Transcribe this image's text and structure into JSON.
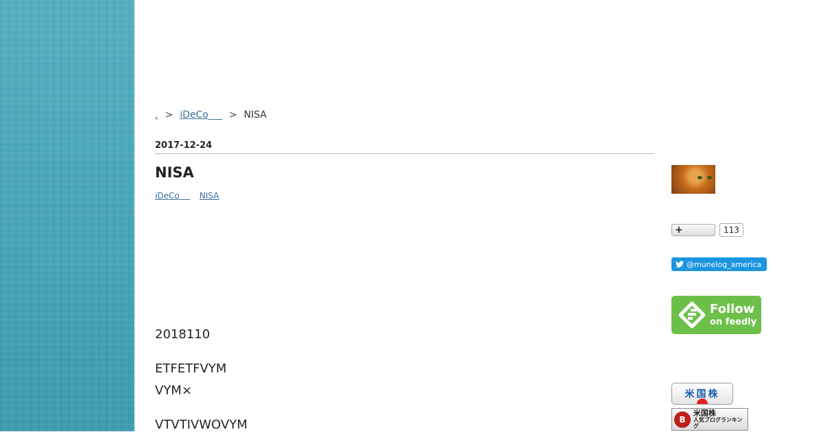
{
  "breadcrumb": {
    "home_label": ".",
    "separator": ">",
    "category_label": "iDeCo",
    "current_label": "NISA"
  },
  "entry": {
    "date": "2017-12-24",
    "title": "NISA",
    "categories": [
      "iDeCo",
      "NISA"
    ],
    "paragraphs": [
      "2018110",
      "ETFETFVYM",
      "VYM×",
      "VTVTIVWOVYM"
    ]
  },
  "sidebar": {
    "subscribe_icon": "+",
    "subscriber_count": "113",
    "twitter_label": "@munelog_america",
    "feedly_line1": "Follow",
    "feedly_line2": "on feedly",
    "badge1_label": "米国株",
    "badge2_line1": "米国株",
    "badge2_line2": "人気ブログランキング"
  },
  "colors": {
    "side_strip": "#4aa6b8",
    "link": "#3b6e9e",
    "twitter": "#1b95e0",
    "feedly": "#6cc04a"
  }
}
